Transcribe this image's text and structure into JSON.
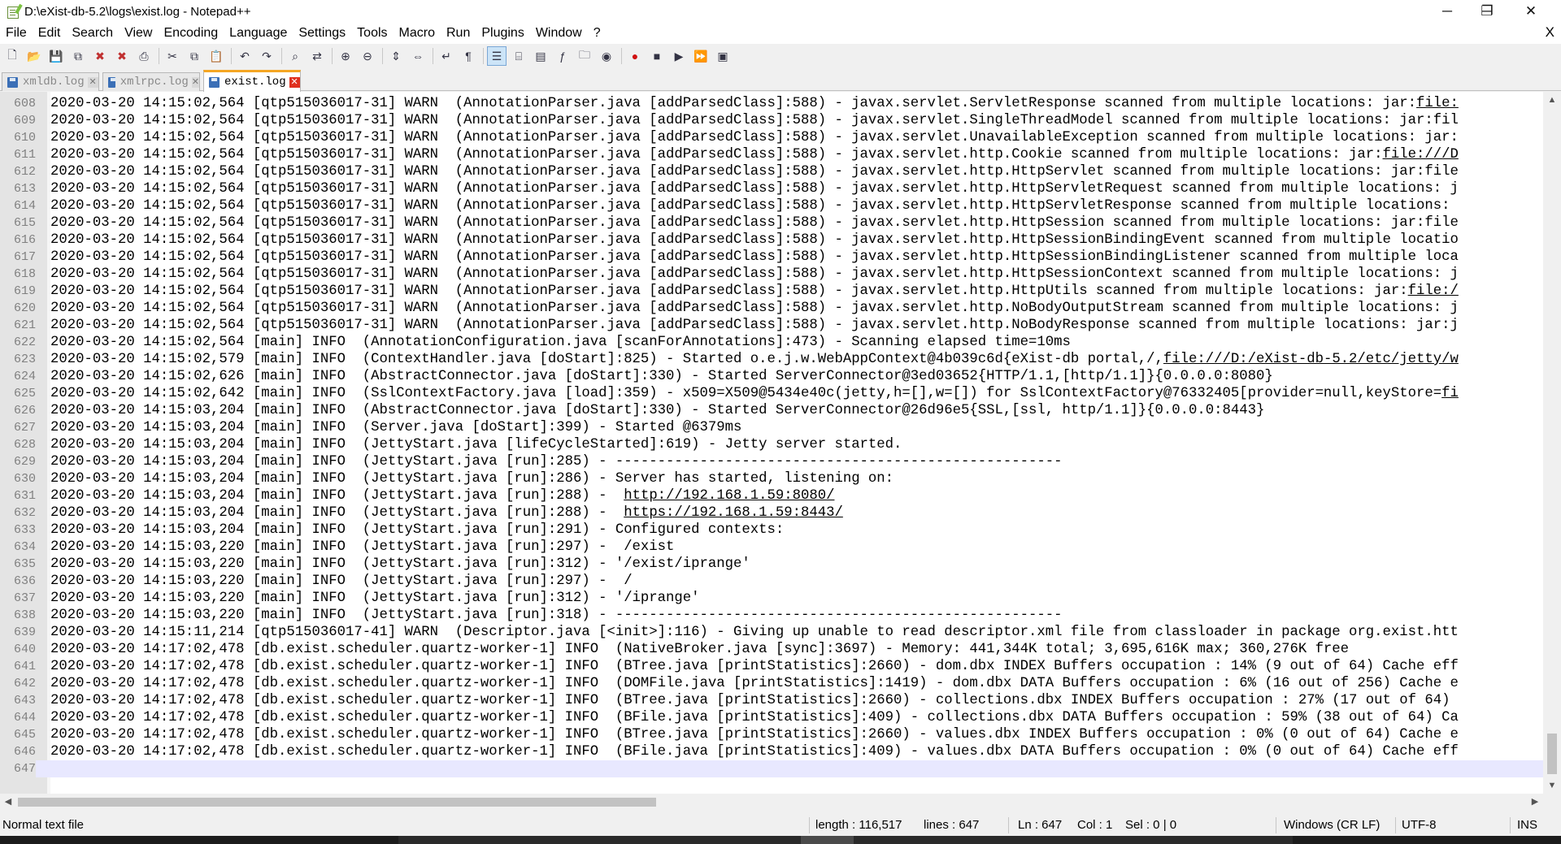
{
  "window": {
    "title": "D:\\eXist-db-5.2\\logs\\exist.log - Notepad++",
    "minimize_glyph": "─",
    "maximize_glyph": "❐",
    "close_glyph": "✕"
  },
  "menu": {
    "items": [
      "File",
      "Edit",
      "Search",
      "View",
      "Encoding",
      "Language",
      "Settings",
      "Tools",
      "Macro",
      "Run",
      "Plugins",
      "Window",
      "?"
    ],
    "close_glyph": "X"
  },
  "toolbar": {
    "icons": [
      "new-icon",
      "open-icon",
      "save-icon",
      "save-all-icon",
      "close-icon",
      "close-all-icon",
      "print-icon",
      "cut-icon",
      "copy-icon",
      "paste-icon",
      "undo-icon",
      "redo-icon",
      "find-icon",
      "replace-icon",
      "zoom-in-icon",
      "zoom-out-icon",
      "sync-v-icon",
      "sync-h-icon",
      "word-wrap-icon",
      "all-chars-icon",
      "indent-guide-icon",
      "udl-icon",
      "doc-map-icon",
      "function-list-icon",
      "folder-workspace-icon",
      "monitoring-icon",
      "record-macro-icon",
      "stop-macro-icon",
      "play-macro-icon",
      "run-macro-multiple-icon",
      "save-macro-icon"
    ]
  },
  "tabs": [
    {
      "label": "xmldb.log",
      "active": false
    },
    {
      "label": "xmlrpc.log",
      "active": false
    },
    {
      "label": "exist.log",
      "active": true
    }
  ],
  "editor": {
    "lines": [
      {
        "n": "608",
        "text": "2020-03-20 14:15:02,564 [qtp515036017-31] WARN  (AnnotationParser.java [addParsedClass]:588) - javax.servlet.ServletResponse scanned from multiple locations: jar:file:"
      },
      {
        "n": "609",
        "text": "2020-03-20 14:15:02,564 [qtp515036017-31] WARN  (AnnotationParser.java [addParsedClass]:588) - javax.servlet.SingleThreadModel scanned from multiple locations: jar:fil"
      },
      {
        "n": "610",
        "text": "2020-03-20 14:15:02,564 [qtp515036017-31] WARN  (AnnotationParser.java [addParsedClass]:588) - javax.servlet.UnavailableException scanned from multiple locations: jar:"
      },
      {
        "n": "611",
        "text": "2020-03-20 14:15:02,564 [qtp515036017-31] WARN  (AnnotationParser.java [addParsedClass]:588) - javax.servlet.http.Cookie scanned from multiple locations: jar:file:///D"
      },
      {
        "n": "612",
        "text": "2020-03-20 14:15:02,564 [qtp515036017-31] WARN  (AnnotationParser.java [addParsedClass]:588) - javax.servlet.http.HttpServlet scanned from multiple locations: jar:file"
      },
      {
        "n": "613",
        "text": "2020-03-20 14:15:02,564 [qtp515036017-31] WARN  (AnnotationParser.java [addParsedClass]:588) - javax.servlet.http.HttpServletRequest scanned from multiple locations: j"
      },
      {
        "n": "614",
        "text": "2020-03-20 14:15:02,564 [qtp515036017-31] WARN  (AnnotationParser.java [addParsedClass]:588) - javax.servlet.http.HttpServletResponse scanned from multiple locations:"
      },
      {
        "n": "615",
        "text": "2020-03-20 14:15:02,564 [qtp515036017-31] WARN  (AnnotationParser.java [addParsedClass]:588) - javax.servlet.http.HttpSession scanned from multiple locations: jar:file"
      },
      {
        "n": "616",
        "text": "2020-03-20 14:15:02,564 [qtp515036017-31] WARN  (AnnotationParser.java [addParsedClass]:588) - javax.servlet.http.HttpSessionBindingEvent scanned from multiple locatio"
      },
      {
        "n": "617",
        "text": "2020-03-20 14:15:02,564 [qtp515036017-31] WARN  (AnnotationParser.java [addParsedClass]:588) - javax.servlet.http.HttpSessionBindingListener scanned from multiple loca"
      },
      {
        "n": "618",
        "text": "2020-03-20 14:15:02,564 [qtp515036017-31] WARN  (AnnotationParser.java [addParsedClass]:588) - javax.servlet.http.HttpSessionContext scanned from multiple locations: j"
      },
      {
        "n": "619",
        "text": "2020-03-20 14:15:02,564 [qtp515036017-31] WARN  (AnnotationParser.java [addParsedClass]:588) - javax.servlet.http.HttpUtils scanned from multiple locations: jar:file:/"
      },
      {
        "n": "620",
        "text": "2020-03-20 14:15:02,564 [qtp515036017-31] WARN  (AnnotationParser.java [addParsedClass]:588) - javax.servlet.http.NoBodyOutputStream scanned from multiple locations: j"
      },
      {
        "n": "621",
        "text": "2020-03-20 14:15:02,564 [qtp515036017-31] WARN  (AnnotationParser.java [addParsedClass]:588) - javax.servlet.http.NoBodyResponse scanned from multiple locations: jar:j"
      },
      {
        "n": "622",
        "text": "2020-03-20 14:15:02,564 [main] INFO  (AnnotationConfiguration.java [scanForAnnotations]:473) - Scanning elapsed time=10ms"
      },
      {
        "n": "623",
        "text": "2020-03-20 14:15:02,579 [main] INFO  (ContextHandler.java [doStart]:825) - Started o.e.j.w.WebAppContext@4b039c6d{eXist-db portal,/,file:///D:/eXist-db-5.2/etc/jetty/w"
      },
      {
        "n": "624",
        "text": "2020-03-20 14:15:02,626 [main] INFO  (AbstractConnector.java [doStart]:330) - Started ServerConnector@3ed03652{HTTP/1.1,[http/1.1]}{0.0.0.0:8080}"
      },
      {
        "n": "625",
        "text": "2020-03-20 14:15:02,642 [main] INFO  (SslContextFactory.java [load]:359) - x509=X509@5434e40c(jetty,h=[],w=[]) for SslContextFactory@76332405[provider=null,keyStore=fi"
      },
      {
        "n": "626",
        "text": "2020-03-20 14:15:03,204 [main] INFO  (AbstractConnector.java [doStart]:330) - Started ServerConnector@26d96e5{SSL,[ssl, http/1.1]}{0.0.0.0:8443}"
      },
      {
        "n": "627",
        "text": "2020-03-20 14:15:03,204 [main] INFO  (Server.java [doStart]:399) - Started @6379ms"
      },
      {
        "n": "628",
        "text": "2020-03-20 14:15:03,204 [main] INFO  (JettyStart.java [lifeCycleStarted]:619) - Jetty server started."
      },
      {
        "n": "629",
        "text": "2020-03-20 14:15:03,204 [main] INFO  (JettyStart.java [run]:285) - -----------------------------------------------------"
      },
      {
        "n": "630",
        "text": "2020-03-20 14:15:03,204 [main] INFO  (JettyStart.java [run]:286) - Server has started, listening on:"
      },
      {
        "n": "631",
        "text": "2020-03-20 14:15:03,204 [main] INFO  (JettyStart.java [run]:288) -  http://192.168.1.59:8080/"
      },
      {
        "n": "632",
        "text": "2020-03-20 14:15:03,204 [main] INFO  (JettyStart.java [run]:288) -  https://192.168.1.59:8443/"
      },
      {
        "n": "633",
        "text": "2020-03-20 14:15:03,204 [main] INFO  (JettyStart.java [run]:291) - Configured contexts:"
      },
      {
        "n": "634",
        "text": "2020-03-20 14:15:03,220 [main] INFO  (JettyStart.java [run]:297) -  /exist"
      },
      {
        "n": "635",
        "text": "2020-03-20 14:15:03,220 [main] INFO  (JettyStart.java [run]:312) - '/exist/iprange'"
      },
      {
        "n": "636",
        "text": "2020-03-20 14:15:03,220 [main] INFO  (JettyStart.java [run]:297) -  /"
      },
      {
        "n": "637",
        "text": "2020-03-20 14:15:03,220 [main] INFO  (JettyStart.java [run]:312) - '/iprange'"
      },
      {
        "n": "638",
        "text": "2020-03-20 14:15:03,220 [main] INFO  (JettyStart.java [run]:318) - -----------------------------------------------------"
      },
      {
        "n": "639",
        "text": "2020-03-20 14:15:11,214 [qtp515036017-41] WARN  (Descriptor.java [<init>]:116) - Giving up unable to read descriptor.xml file from classloader in package org.exist.htt"
      },
      {
        "n": "640",
        "text": "2020-03-20 14:17:02,478 [db.exist.scheduler.quartz-worker-1] INFO  (NativeBroker.java [sync]:3697) - Memory: 441,344K total; 3,695,616K max; 360,276K free"
      },
      {
        "n": "641",
        "text": "2020-03-20 14:17:02,478 [db.exist.scheduler.quartz-worker-1] INFO  (BTree.java [printStatistics]:2660) - dom.dbx INDEX Buffers occupation : 14% (9 out of 64) Cache eff"
      },
      {
        "n": "642",
        "text": "2020-03-20 14:17:02,478 [db.exist.scheduler.quartz-worker-1] INFO  (DOMFile.java [printStatistics]:1419) - dom.dbx DATA Buffers occupation : 6% (16 out of 256) Cache e"
      },
      {
        "n": "643",
        "text": "2020-03-20 14:17:02,478 [db.exist.scheduler.quartz-worker-1] INFO  (BTree.java [printStatistics]:2660) - collections.dbx INDEX Buffers occupation : 27% (17 out of 64)"
      },
      {
        "n": "644",
        "text": "2020-03-20 14:17:02,478 [db.exist.scheduler.quartz-worker-1] INFO  (BFile.java [printStatistics]:409) - collections.dbx DATA Buffers occupation : 59% (38 out of 64) Ca"
      },
      {
        "n": "645",
        "text": "2020-03-20 14:17:02,478 [db.exist.scheduler.quartz-worker-1] INFO  (BTree.java [printStatistics]:2660) - values.dbx INDEX Buffers occupation : 0% (0 out of 64) Cache e"
      },
      {
        "n": "646",
        "text": "2020-03-20 14:17:02,478 [db.exist.scheduler.quartz-worker-1] INFO  (BFile.java [printStatistics]:409) - values.dbx DATA Buffers occupation : 0% (0 out of 64) Cache eff"
      },
      {
        "n": "647",
        "text": ""
      }
    ],
    "current_line": "647",
    "links": [
      "file:",
      "fil",
      "file:///D",
      "file",
      "file:/",
      "file:///D:/eXist-db-5.2/etc/jetty/w",
      "fi",
      "http://192.168.1.59:8080/",
      "https://192.168.1.59:8443/"
    ]
  },
  "statusbar": {
    "file_type": "Normal text file",
    "length": "length : 116,517",
    "lines": "lines : 647",
    "ln": "Ln : 647",
    "col": "Col : 1",
    "sel": "Sel : 0 | 0",
    "eol": "Windows (CR LF)",
    "encoding": "UTF-8",
    "mode": "INS"
  }
}
